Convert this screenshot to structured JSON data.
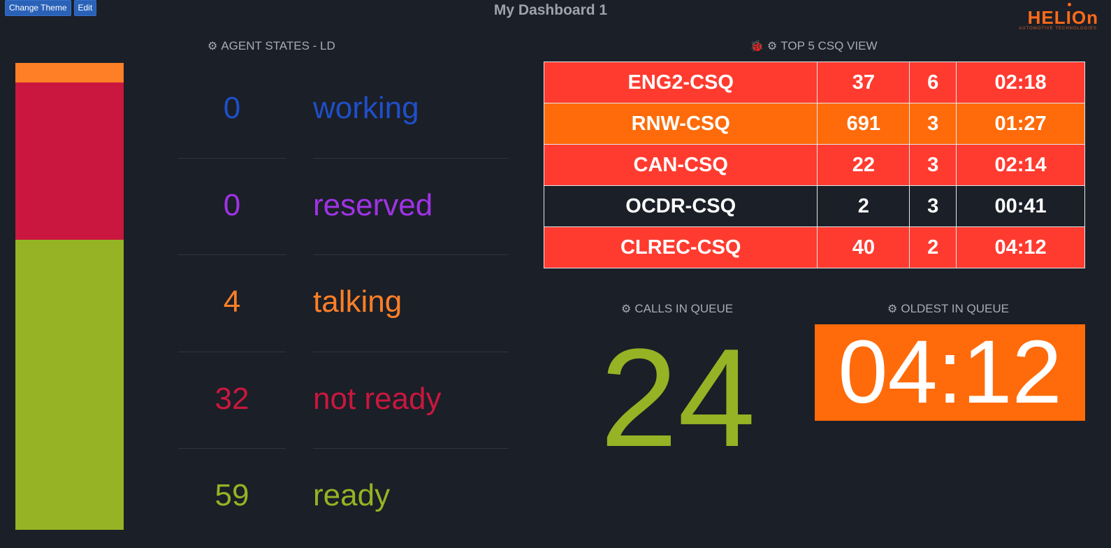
{
  "toolbar": {
    "change_theme_label": "Change Theme",
    "edit_label": "Edit"
  },
  "dashboard": {
    "title": "My Dashboard 1"
  },
  "logo": {
    "text": "HELIOn",
    "tagline": "AUTOMOTIVE TECHNOLOGIES"
  },
  "agent_states": {
    "title": "AGENT STATES - LD",
    "states": [
      {
        "count": "0",
        "label": "working",
        "color": "#1f4fc9"
      },
      {
        "count": "0",
        "label": "reserved",
        "color": "#a033e6"
      },
      {
        "count": "4",
        "label": "talking",
        "color": "#ff7f27"
      },
      {
        "count": "32",
        "label": "not ready",
        "color": "#c9173f"
      },
      {
        "count": "59",
        "label": "ready",
        "color": "#95b324"
      }
    ]
  },
  "agent_stack": {
    "segments": [
      {
        "state": "talking",
        "value": 4,
        "color": "#ff7f27"
      },
      {
        "state": "not ready",
        "value": 32,
        "color": "#c9173f"
      },
      {
        "state": "ready",
        "value": 59,
        "color": "#95b324"
      }
    ]
  },
  "csq_view": {
    "title": "TOP 5 CSQ VIEW",
    "rows": [
      {
        "name": "ENG2-CSQ",
        "col2": "37",
        "col3": "6",
        "time": "02:18",
        "color": "#ff3b30"
      },
      {
        "name": "RNW-CSQ",
        "col2": "691",
        "col3": "3",
        "time": "01:27",
        "color": "#ff6b0a"
      },
      {
        "name": "CAN-CSQ",
        "col2": "22",
        "col3": "3",
        "time": "02:14",
        "color": "#ff3b30"
      },
      {
        "name": "OCDR-CSQ",
        "col2": "2",
        "col3": "3",
        "time": "00:41",
        "color": "#1b1f27"
      },
      {
        "name": "CLREC-CSQ",
        "col2": "40",
        "col3": "2",
        "time": "04:12",
        "color": "#ff3b30"
      }
    ]
  },
  "calls_in_queue": {
    "title": "CALLS IN QUEUE",
    "value": "24"
  },
  "oldest_in_queue": {
    "title": "OLDEST IN QUEUE",
    "value": "04:12"
  }
}
